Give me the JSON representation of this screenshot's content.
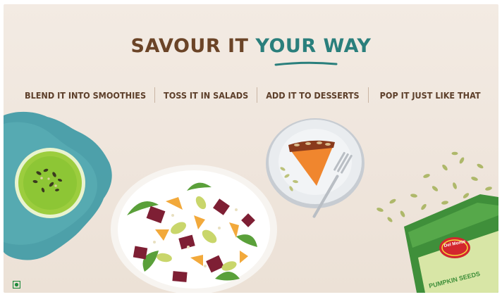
{
  "hero": {
    "title_part1": "SAVOUR IT",
    "title_part2": "YOUR WAY"
  },
  "nav": {
    "items": [
      {
        "label": "BLEND IT INTO SMOOTHIES"
      },
      {
        "label": "TOSS IT IN SALADS"
      },
      {
        "label": "ADD IT TO DESSERTS"
      },
      {
        "label": "POP IT JUST LIKE THAT"
      }
    ]
  },
  "product": {
    "brand": "Del Monte",
    "name": "PUMPKIN SEEDS"
  },
  "colors": {
    "title_brown": "#6b4427",
    "title_teal": "#2a7f7c",
    "nav_text": "#5d3f2a",
    "background": "#efe5dc",
    "pack_green": "#3f8f3a"
  },
  "icons": {
    "corner": "veg-mark-icon"
  }
}
